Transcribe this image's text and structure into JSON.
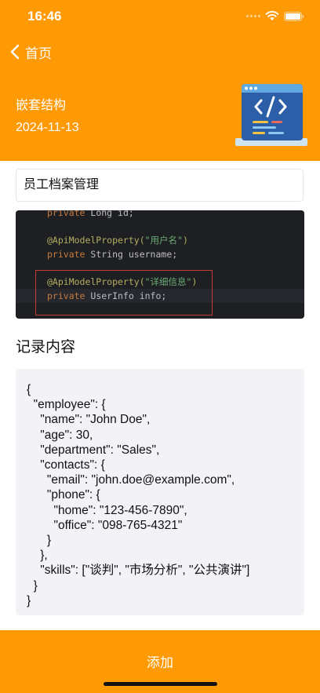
{
  "status_bar": {
    "time": "16:46"
  },
  "nav": {
    "back_label": "首页"
  },
  "header": {
    "category": "嵌套结构",
    "date": "2024-11-13"
  },
  "record": {
    "title_value": "员工档案管理"
  },
  "code_image": {
    "lines": [
      {
        "keyword": "private ",
        "type": "Long ",
        "name": "id;"
      },
      {
        "annotation": "@ApiModelProperty(",
        "string": "\"用户名\"",
        "close": ")"
      },
      {
        "keyword": "private ",
        "type": "String ",
        "name": "username;"
      },
      {
        "annotation": "@ApiModelProperty(",
        "string": "\"详细信息\"",
        "close": ")"
      },
      {
        "keyword": "private ",
        "type": "UserInfo ",
        "name": "info;"
      }
    ]
  },
  "content": {
    "section_title": "记录内容",
    "json_text": "{\n  \"employee\": {\n    \"name\": \"John Doe\",\n    \"age\": 30,\n    \"department\": \"Sales\",\n    \"contacts\": {\n      \"email\": \"john.doe@example.com\",\n      \"phone\": {\n        \"home\": \"123-456-7890\",\n        \"office\": \"098-765-4321\"\n      }\n    },\n    \"skills\": [\"谈判\", \"市场分析\", \"公共演讲\"]\n  }\n}"
  },
  "footer": {
    "add_label": "添加"
  },
  "colors": {
    "accent": "#FF9A04",
    "code_bg": "#1E1F22",
    "json_bg": "#F2F2F7"
  },
  "icons": [
    "wifi-icon",
    "battery-icon",
    "back-chevron-icon",
    "code-illustration-icon"
  ]
}
